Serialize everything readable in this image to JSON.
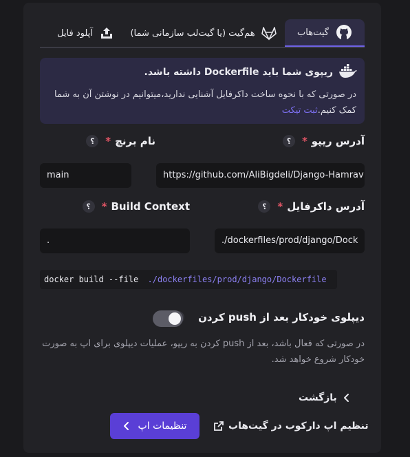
{
  "tabs": [
    {
      "label": "گیت‌هاب",
      "icon": "github-icon",
      "active": true
    },
    {
      "label": "هم‌گیت (یا گیت‌لب سازمانی شما)",
      "icon": "gitlab-icon",
      "active": false
    },
    {
      "label": "آپلود فایل",
      "icon": "upload-icon",
      "active": false
    }
  ],
  "info": {
    "icon": "docker-icon",
    "title": "ریپوی شما باید Dockerfile داشته باشد.",
    "body": "در صورتی که با نحوه ساخت داکرفایل آشنایی ندارید،میتوانیم در نوشتن آن به شما کمک کنیم.",
    "link": "ثبت تیکت"
  },
  "fields": {
    "repo": {
      "label": "آدرس ریپو",
      "required": "*",
      "help": "؟",
      "value": "https://github.com/AliBigdeli/Django-Hamrav"
    },
    "branch": {
      "label": "نام برنچ",
      "required": "*",
      "help": "؟",
      "value": "main"
    },
    "dockerfile": {
      "label": "آدرس داکرفایل",
      "required": "*",
      "help": "؟",
      "value": "./dockerfiles/prod/django/Dock"
    },
    "context": {
      "label": "Build Context",
      "required": "*",
      "help": "؟",
      "value": "."
    }
  },
  "command": {
    "prefix": "docker build --file",
    "path": "./dockerfiles/prod/django/Dockerfile",
    "suffix": "."
  },
  "autodeploy": {
    "label": "دیپلوی خودکار بعد از push کردن",
    "help": "؟",
    "enabled": true,
    "description": "در صورتی که فعال باشد، بعد از push کردن به ریپو، عملیات دیپلوی برای اپ به صورت خودکار شروع خواهد شد."
  },
  "actions": {
    "back": "بازگشت",
    "link": "تنظیم اپ دارکوب در گیت‌هاب",
    "primary": "تنظیمات اپ"
  },
  "colors": {
    "accent": "#5a3fd6",
    "link": "#7c6ff0",
    "required": "#e05565",
    "panel": "#222226",
    "info_bg": "#2c2a44"
  }
}
